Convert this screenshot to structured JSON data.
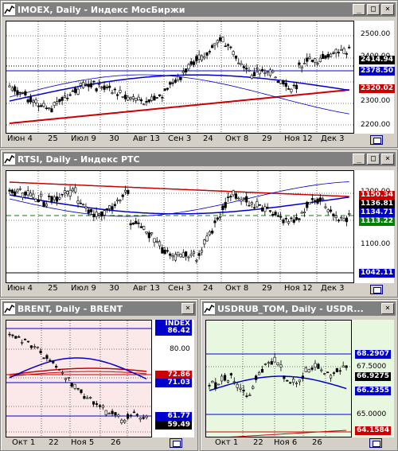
{
  "colors": {
    "window_bg": "#d4d0c8",
    "titlebar": "#808080",
    "plot_white": "#ffffff",
    "plot_pink": "#fbe9e9",
    "plot_green": "#e8f7e0",
    "ma_blue": "#0000cc",
    "ma_red": "#cc0000",
    "candle_up": "#008000"
  },
  "windows": [
    {
      "id": "imoex",
      "title": "IMOEX, Daily - Индекс МосБиржи",
      "icon": "chart-icon",
      "y_labels": [
        "2500.00",
        "2400.00",
        "2300.00",
        "2200.00"
      ],
      "price_boxes": [
        {
          "label": "2414.94",
          "bg": "#000000",
          "fg": "#ffffff"
        },
        {
          "label": "2378.50",
          "bg": "#0000cc",
          "fg": "#ffffff"
        },
        {
          "label": "2320.02",
          "bg": "#cc0000",
          "fg": "#ffffff"
        }
      ],
      "x_labels": [
        "Июн 4",
        "25",
        "Июл 9",
        "30",
        "Авг 13",
        "Сен 3",
        "24",
        "Окт 8",
        "29",
        "Ноя 12",
        "Дек 3"
      ]
    },
    {
      "id": "rtsi",
      "title": "RTSI, Daily - Индекс РТС",
      "icon": "chart-icon",
      "y_labels": [
        "1200.00",
        "1100.00"
      ],
      "price_boxes": [
        {
          "label": "1150.34",
          "bg": "#cc0000",
          "fg": "#ffffff"
        },
        {
          "label": "1136.81",
          "bg": "#000000",
          "fg": "#ffffff"
        },
        {
          "label": "1134.71",
          "bg": "#0000cc",
          "fg": "#ffffff"
        },
        {
          "label": "1113.22",
          "bg": "#008000",
          "fg": "#ffffff"
        },
        {
          "label": "1042.11",
          "bg": "#0000cc",
          "fg": "#ffffff"
        }
      ],
      "x_labels": [
        "Июн 4",
        "25",
        "Июл 9",
        "30",
        "Авг 13",
        "Сен 3",
        "24",
        "Окт 8",
        "29",
        "Ноя 12",
        "Дек 3"
      ]
    },
    {
      "id": "brent",
      "title": "BRENT, Daily - BRENT",
      "icon": "chart-icon",
      "index_label": "INDEX",
      "y_labels": [
        "80.00"
      ],
      "price_boxes": [
        {
          "label": "86.42",
          "bg": "#0000cc",
          "fg": "#ffffff"
        },
        {
          "label": "72.86",
          "bg": "#cc0000",
          "fg": "#ffffff"
        },
        {
          "label": "71.03",
          "bg": "#0000cc",
          "fg": "#ffffff"
        },
        {
          "label": "61.77",
          "bg": "#0000cc",
          "fg": "#ffffff"
        },
        {
          "label": "59.49",
          "bg": "#000000",
          "fg": "#ffffff"
        }
      ],
      "x_labels": [
        "Окт 1",
        "22",
        "Ноя 5",
        "26"
      ]
    },
    {
      "id": "usdrub",
      "title": "USDRUB_TOM, Daily - USDR...",
      "icon": "chart-icon",
      "y_labels": [
        "67.5000",
        "65.0000"
      ],
      "price_boxes": [
        {
          "label": "68.2907",
          "bg": "#0000cc",
          "fg": "#ffffff"
        },
        {
          "label": "66.9275",
          "bg": "#000000",
          "fg": "#ffffff"
        },
        {
          "label": "66.2355",
          "bg": "#0000cc",
          "fg": "#ffffff"
        },
        {
          "label": "65.0000",
          "bg": "#0000cc",
          "fg": "#ffffff"
        },
        {
          "label": "64.1584",
          "bg": "#cc0000",
          "fg": "#ffffff"
        }
      ],
      "x_labels": [
        "Окт 1",
        "22",
        "Ноя 6",
        "26"
      ]
    }
  ],
  "window_buttons": {
    "minimize": "_",
    "maximize": "□",
    "close": "×"
  }
}
